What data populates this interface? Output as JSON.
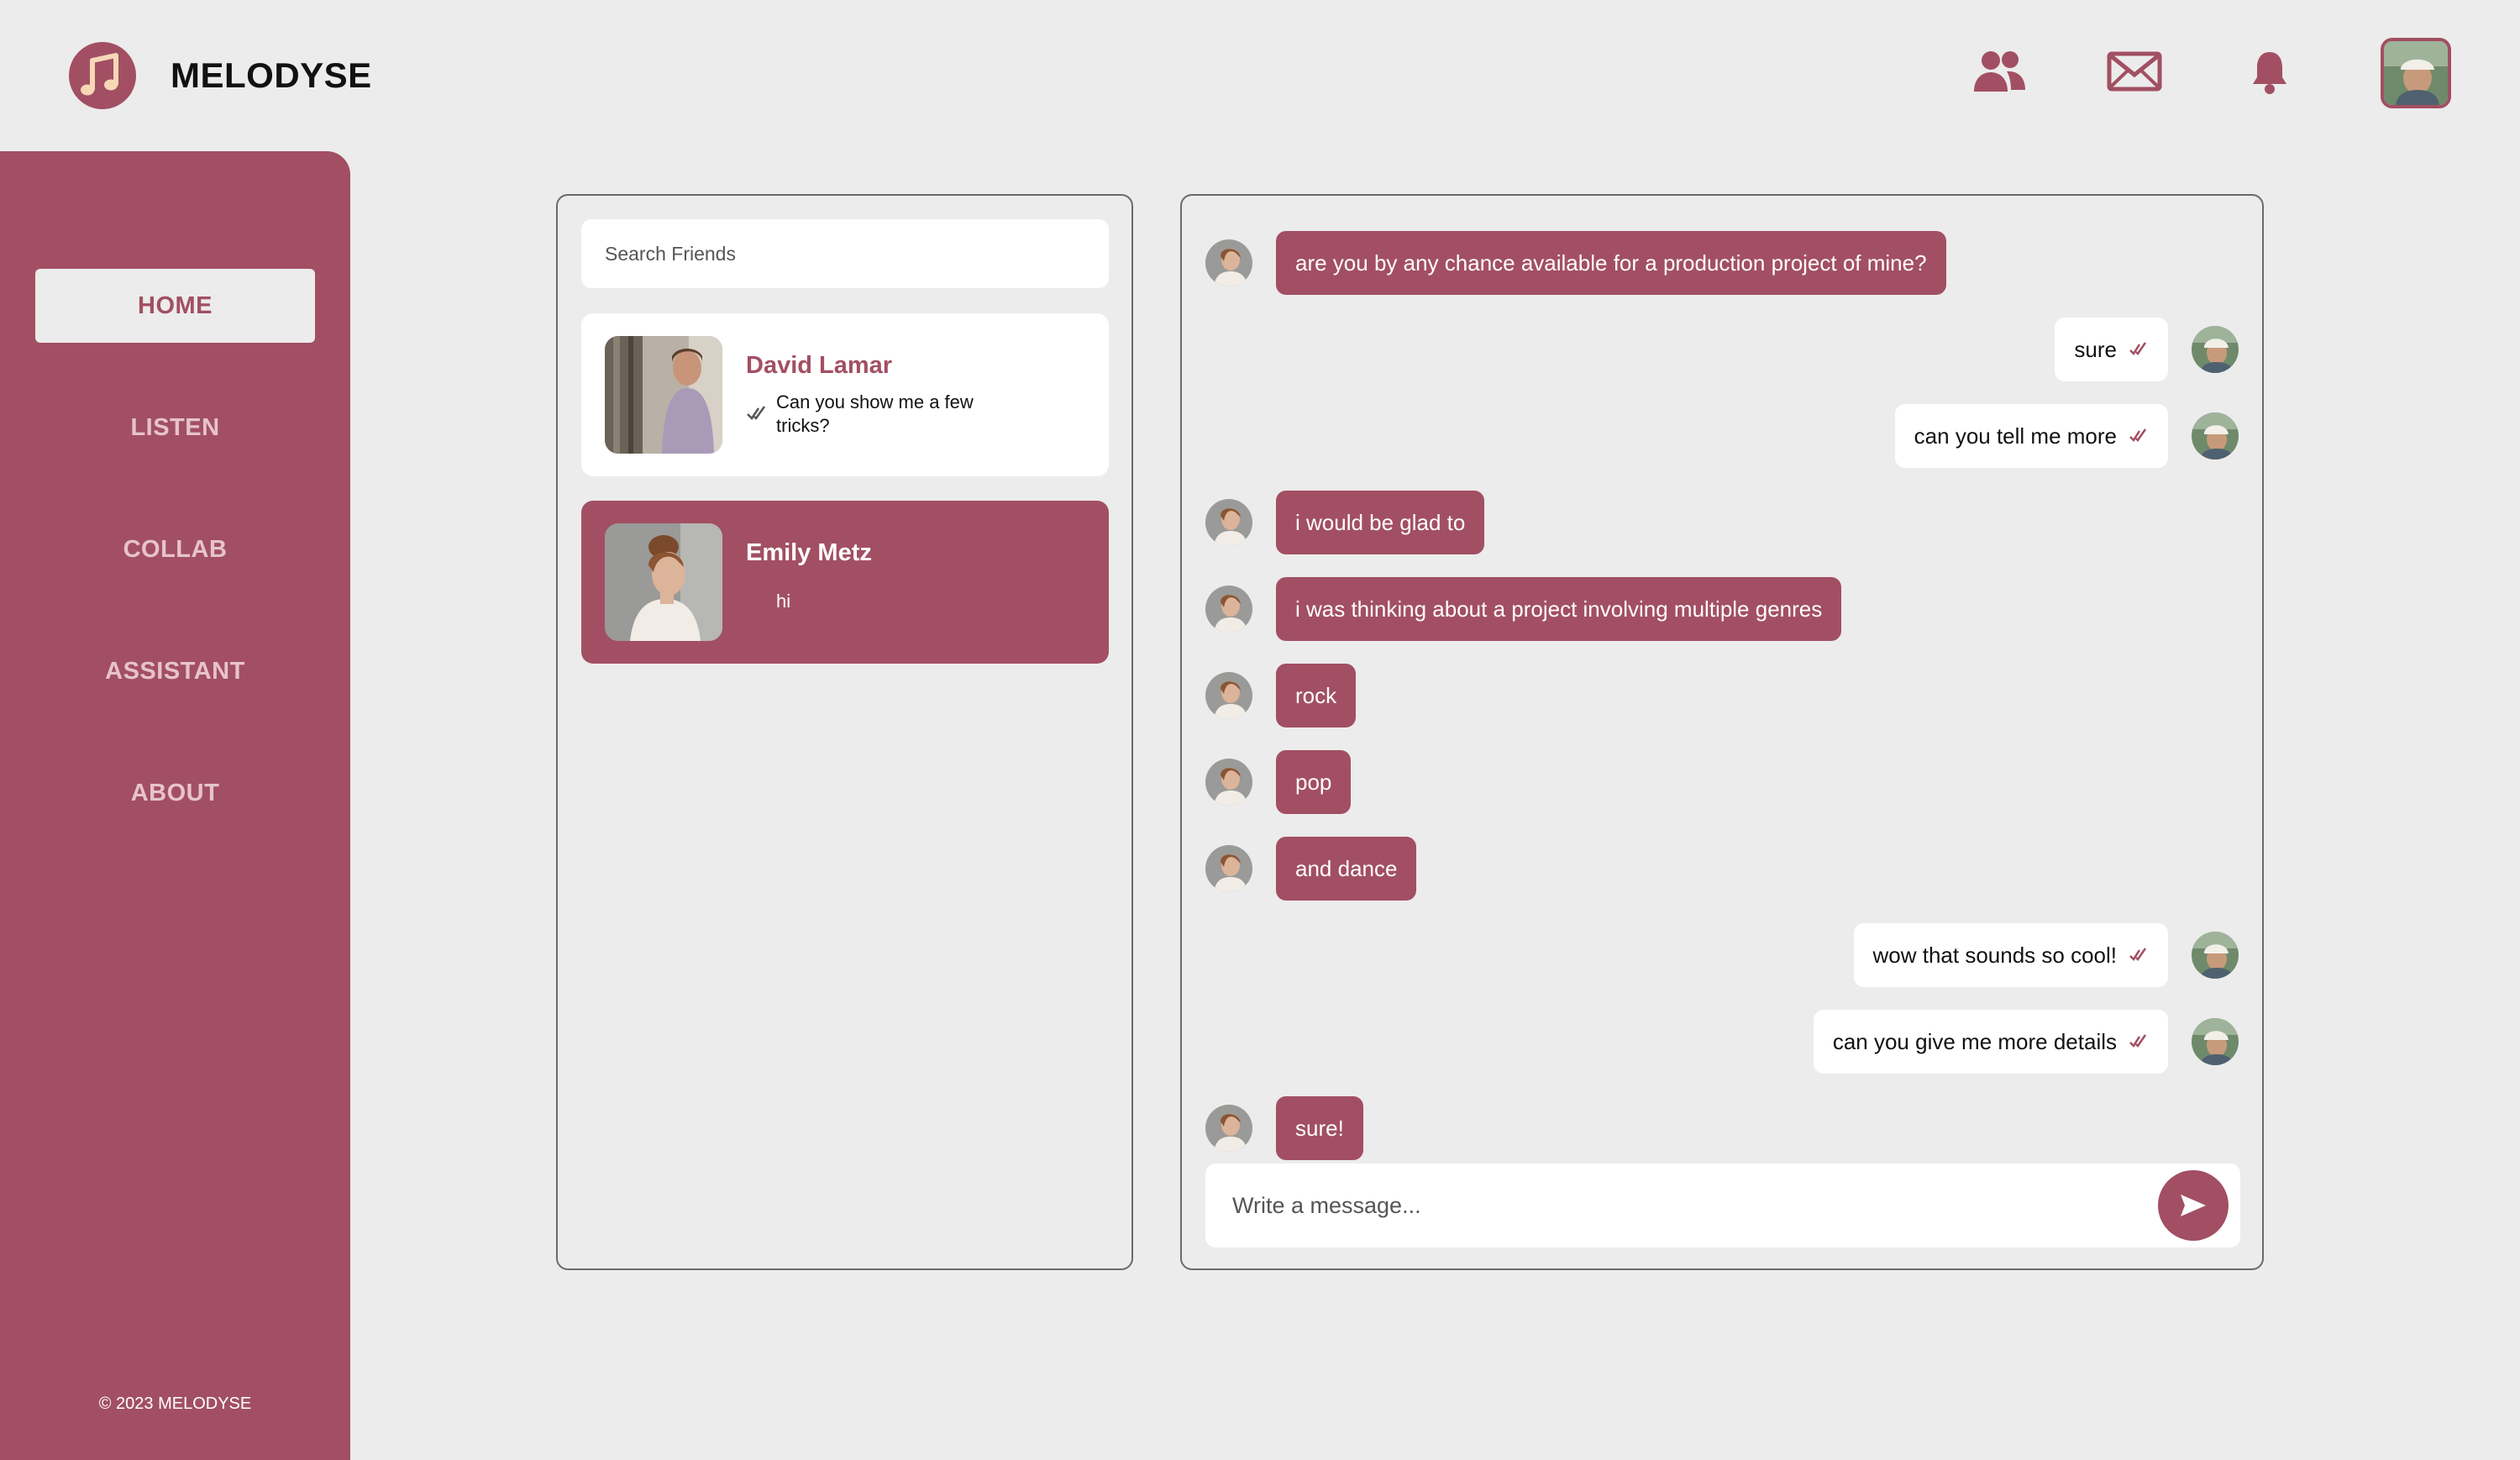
{
  "header": {
    "brand": "MELODYSE",
    "icons": [
      "friends-icon",
      "mail-icon",
      "bell-icon"
    ],
    "accent_color": "#a24f63"
  },
  "sidebar": {
    "items": [
      {
        "label": "HOME",
        "active": true
      },
      {
        "label": "LISTEN",
        "active": false
      },
      {
        "label": "COLLAB",
        "active": false
      },
      {
        "label": "ASSISTANT",
        "active": false
      },
      {
        "label": "ABOUT",
        "active": false
      }
    ],
    "copyright": "© 2023 MELODYSE"
  },
  "friends": {
    "search_placeholder": "Search Friends",
    "list": [
      {
        "name": "David Lamar",
        "last_message": "Can you show me a few tricks?",
        "read": true,
        "active": false
      },
      {
        "name": "Emily Metz",
        "last_message": "hi",
        "read": false,
        "active": true
      }
    ]
  },
  "chat": {
    "messages": [
      {
        "dir": "in",
        "text": "are you by any chance available for a production project of mine?"
      },
      {
        "dir": "out",
        "text": "sure"
      },
      {
        "dir": "out",
        "text": "can you tell me more"
      },
      {
        "dir": "in",
        "text": "i would be glad to"
      },
      {
        "dir": "in",
        "text": "i was thinking about a project involving multiple genres"
      },
      {
        "dir": "in",
        "text": "rock"
      },
      {
        "dir": "in",
        "text": "pop"
      },
      {
        "dir": "in",
        "text": "and dance"
      },
      {
        "dir": "out",
        "text": "wow that sounds so cool!"
      },
      {
        "dir": "out",
        "text": "can you give me more details"
      },
      {
        "dir": "in",
        "text": "sure!"
      }
    ],
    "composer_placeholder": "Write a message..."
  }
}
